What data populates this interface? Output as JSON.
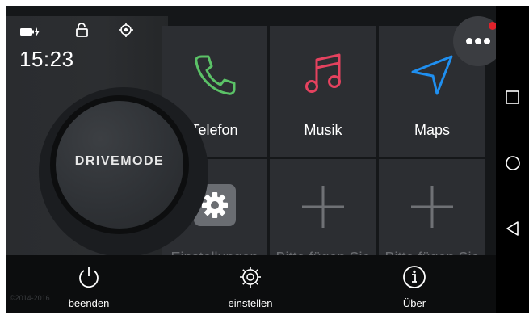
{
  "status": {
    "time": "15:23",
    "battery_icon": "battery-charging-icon",
    "lock_icon": "unlock-icon",
    "location_icon": "location-icon"
  },
  "dial": {
    "label": "DRIVEMODE"
  },
  "tiles": [
    {
      "label": "Telefon",
      "icon": "phone-icon",
      "color": "#5bc267"
    },
    {
      "label": "Musik",
      "icon": "music-icon",
      "color": "#e5425f"
    },
    {
      "label": "Maps",
      "icon": "navigation-icon",
      "color": "#1f8ff0"
    },
    {
      "label": "Einstellungen",
      "icon": "settings-icon"
    },
    {
      "label": "Bitte fügen Sie",
      "icon": "plus-icon"
    },
    {
      "label": "Bitte fügen Sie",
      "icon": "plus-icon"
    }
  ],
  "bottom_bar": {
    "items": [
      {
        "label": "beenden",
        "icon": "power-icon"
      },
      {
        "label": "einstellen",
        "icon": "gear-icon"
      },
      {
        "label": "Über",
        "icon": "info-icon"
      }
    ]
  },
  "copyright": "©2014-2016",
  "menu": {
    "icon": "more-dots-icon",
    "badge_color": "#e0222b"
  },
  "navbar": {
    "icons": [
      "recents-icon",
      "home-icon",
      "back-icon"
    ]
  }
}
